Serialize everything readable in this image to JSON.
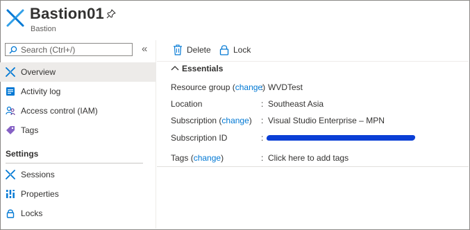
{
  "header": {
    "title": "Bastion01",
    "subtitle": "Bastion",
    "icon": "bastion-icon",
    "pin_icon": "pin-icon"
  },
  "sidebar": {
    "search_placeholder": "Search (Ctrl+/)",
    "collapse_glyph": "«",
    "items": [
      {
        "label": "Overview",
        "icon": "bastion-icon",
        "active": true
      },
      {
        "label": "Activity log",
        "icon": "activity-log-icon"
      },
      {
        "label": "Access control (IAM)",
        "icon": "people-icon"
      },
      {
        "label": "Tags",
        "icon": "tag-icon"
      }
    ],
    "settings_title": "Settings",
    "settings_items": [
      {
        "label": "Sessions",
        "icon": "bastion-icon"
      },
      {
        "label": "Properties",
        "icon": "properties-icon"
      },
      {
        "label": "Locks",
        "icon": "lock-icon"
      }
    ]
  },
  "toolbar": {
    "delete_label": "Delete",
    "lock_label": "Lock"
  },
  "essentials": {
    "title": "Essentials",
    "rows": {
      "resource_group": {
        "key": "Resource group",
        "change": "change",
        "value": "WVDTest"
      },
      "location": {
        "key": "Location",
        "value": "Southeast Asia"
      },
      "subscription": {
        "key": "Subscription",
        "change": "change",
        "value": "Visual Studio Enterprise – MPN"
      },
      "subscription_id": {
        "key": "Subscription ID"
      },
      "tags": {
        "key": "Tags",
        "change": "change",
        "value": "Click here to add tags"
      }
    }
  },
  "colors": {
    "link": "#0078d4",
    "active_bg": "#edebe9",
    "accent": "#0078d4"
  }
}
